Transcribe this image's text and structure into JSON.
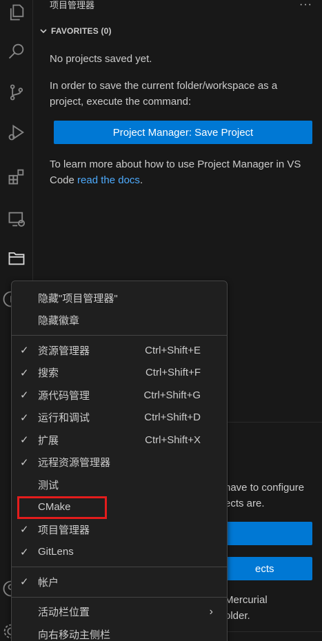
{
  "activity_bar": {
    "icons": [
      "explorer-icon",
      "search-icon",
      "source-control-icon",
      "run-debug-icon",
      "extensions-icon",
      "remote-explorer-icon",
      "project-manager-icon",
      "info-icon",
      "account-icon",
      "settings-icon"
    ]
  },
  "sidebar": {
    "title": "项目管理器",
    "more": "···",
    "section": "FAVORITES (0)",
    "no_projects": "No projects saved yet.",
    "instruction": "In order to save the current folder/workspace as a project, execute the command:",
    "save_button": "Project Manager: Save Project",
    "learn_prefix": "To learn more about how to use Project Manager in VS Code ",
    "learn_link": "read the docs",
    "learn_suffix": "."
  },
  "lower_section": {
    "text1": "have to configure",
    "text1b": "ects are.",
    "button2": "ects",
    "text2": "Mercurial",
    "text2b": "older."
  },
  "context_menu": {
    "top_items": [
      {
        "label": "隐藏\"项目管理器\"",
        "checked": false
      },
      {
        "label": "隐藏徽章",
        "checked": false
      }
    ],
    "view_items": [
      {
        "label": "资源管理器",
        "checked": true,
        "shortcut": "Ctrl+Shift+E"
      },
      {
        "label": "搜索",
        "checked": true,
        "shortcut": "Ctrl+Shift+F"
      },
      {
        "label": "源代码管理",
        "checked": true,
        "shortcut": "Ctrl+Shift+G"
      },
      {
        "label": "运行和调试",
        "checked": true,
        "shortcut": "Ctrl+Shift+D"
      },
      {
        "label": "扩展",
        "checked": true,
        "shortcut": "Ctrl+Shift+X"
      },
      {
        "label": "远程资源管理器",
        "checked": true,
        "shortcut": ""
      },
      {
        "label": "测试",
        "checked": false,
        "shortcut": ""
      },
      {
        "label": "CMake",
        "checked": false,
        "shortcut": ""
      },
      {
        "label": "项目管理器",
        "checked": true,
        "shortcut": ""
      },
      {
        "label": "GitLens",
        "checked": true,
        "shortcut": ""
      }
    ],
    "account_items": [
      {
        "label": "帐户",
        "checked": true
      }
    ],
    "bottom_items": [
      {
        "label": "活动栏位置",
        "submenu": true
      },
      {
        "label": "向右移动主侧栏",
        "submenu": false
      }
    ],
    "check_glyph": "✓",
    "submenu_glyph": "›"
  },
  "colors": {
    "accent": "#0078d4",
    "link": "#4daafc",
    "highlight": "#e41c1c"
  }
}
